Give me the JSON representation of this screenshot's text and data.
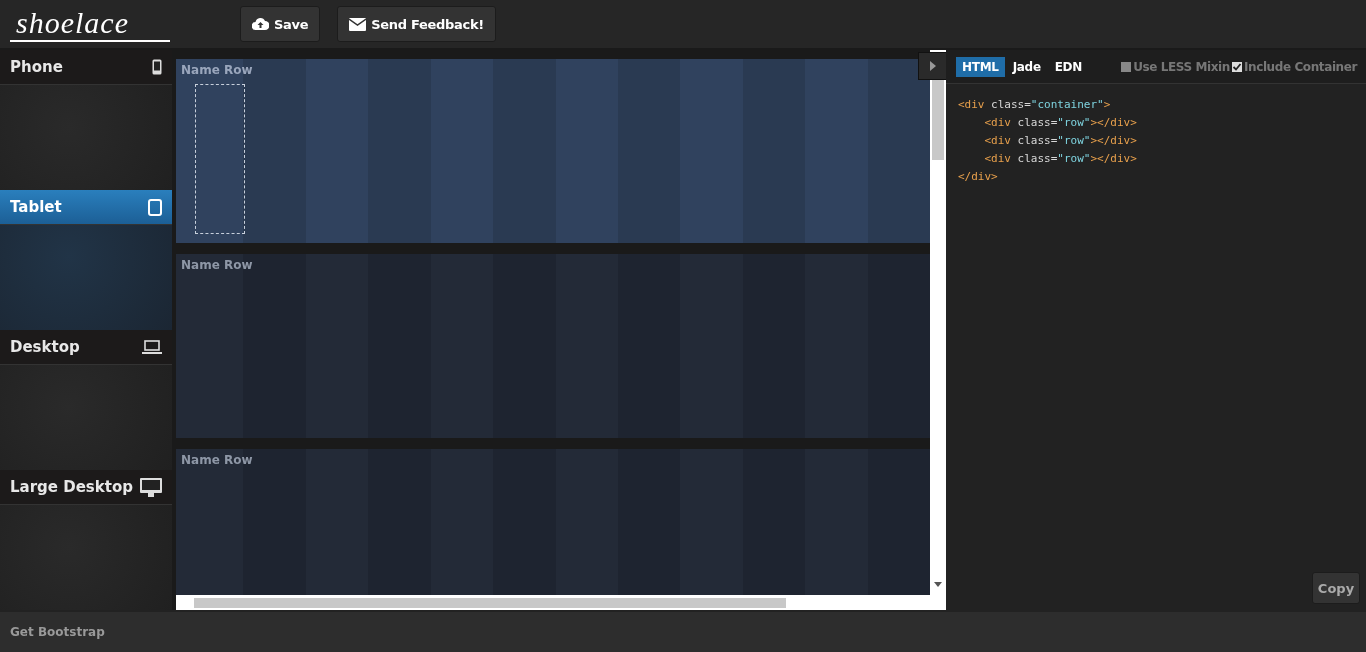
{
  "header": {
    "logo": "shoelace",
    "buttons": [
      {
        "label": "Save",
        "kind": "save"
      },
      {
        "label": "Send Feedback!",
        "kind": "feedback"
      }
    ]
  },
  "sidebar": {
    "items": [
      {
        "label": "Phone",
        "kind": "phone",
        "selected": false
      },
      {
        "label": "Tablet",
        "kind": "tablet",
        "selected": true
      },
      {
        "label": "Desktop",
        "kind": "laptop",
        "selected": false
      },
      {
        "label": "Large Desktop",
        "kind": "monitor",
        "selected": false
      }
    ]
  },
  "canvas": {
    "rows": [
      {
        "label": "Name Row",
        "selected": true,
        "placeholder_column": true
      },
      {
        "label": "Name Row",
        "selected": false,
        "placeholder_column": false
      },
      {
        "label": "Name Row",
        "selected": false,
        "placeholder_column": false
      }
    ]
  },
  "code_panel": {
    "tabs": [
      {
        "label": "HTML",
        "selected": true
      },
      {
        "label": "Jade",
        "selected": false
      },
      {
        "label": "EDN",
        "selected": false
      }
    ],
    "options": [
      {
        "label": "Use LESS Mixin",
        "checked": false
      },
      {
        "label": "Include Container",
        "checked": true
      }
    ],
    "lines": [
      {
        "tokens": [
          {
            "kind": "tag",
            "text": "<div"
          },
          {
            "kind": "attr",
            "text": " class="
          },
          {
            "kind": "string",
            "text": "\"container\""
          },
          {
            "kind": "tag",
            "text": ">"
          }
        ]
      },
      {
        "tokens": [
          {
            "kind": "tag",
            "text": "    <div"
          },
          {
            "kind": "attr",
            "text": " class="
          },
          {
            "kind": "string",
            "text": "\"row\""
          },
          {
            "kind": "tag",
            "text": "></div>"
          }
        ]
      },
      {
        "tokens": [
          {
            "kind": "tag",
            "text": "    <div"
          },
          {
            "kind": "attr",
            "text": " class="
          },
          {
            "kind": "string",
            "text": "\"row\""
          },
          {
            "kind": "tag",
            "text": "></div>"
          }
        ]
      },
      {
        "tokens": [
          {
            "kind": "tag",
            "text": "    <div"
          },
          {
            "kind": "attr",
            "text": " class="
          },
          {
            "kind": "string",
            "text": "\"row\""
          },
          {
            "kind": "tag",
            "text": "></div>"
          }
        ]
      },
      {
        "tokens": [
          {
            "kind": "tag",
            "text": "</div>"
          }
        ]
      }
    ],
    "copy_button": "Copy"
  },
  "footer": {
    "link": "Get Bootstrap"
  }
}
